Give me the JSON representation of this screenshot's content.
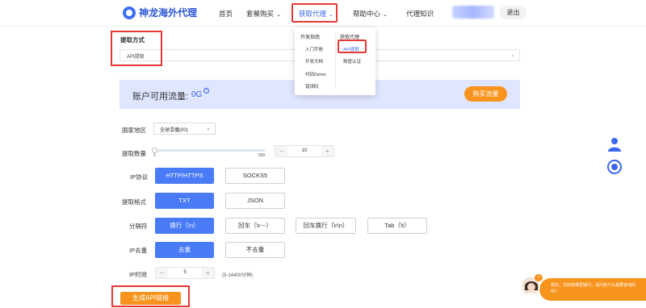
{
  "header": {
    "brand": "神龙海外代理",
    "nav": {
      "home": "首页",
      "packages": "套餐购买",
      "get_proxy": "获取代理",
      "help": "帮助中心",
      "knowledge": "代理知识"
    },
    "logout": "退出"
  },
  "dropdown": {
    "col1": [
      "开发指南",
      "入门手册",
      "开发文档",
      "代码Demo",
      "错误码"
    ],
    "col2": [
      "获取代理",
      "API提取",
      "账密认证"
    ]
  },
  "form": {
    "mode_label": "提取方式",
    "mode_value": "API提取",
    "balance_label": "账户可用流量:",
    "balance_value": "0G",
    "info_glyph": "i",
    "buy_button": "购买流量",
    "region_label": "国家地区",
    "region_value": "全球混播(00)",
    "count_label": "提取数量",
    "slider_min": "1",
    "slider_max": "500",
    "slider_level": 0,
    "count_value": "10",
    "protocol_label": "IP协议",
    "protocol_options": [
      "HTTP/HTTPS",
      "SOCKS5"
    ],
    "format_label": "提取格式",
    "format_options": [
      "TXT",
      "JSON"
    ],
    "separator_label": "分隔符",
    "separator_options": [
      "换行（\\n）",
      "回车（\\r---）",
      "回车换行（\\r\\n）",
      "Tab（\\t）"
    ],
    "dedupe_label": "IP去重",
    "dedupe_options": [
      "去重",
      "不去重"
    ],
    "duration_label": "IP时效",
    "duration_value": "5",
    "duration_hint": "(5-14400分钟)",
    "generate_button": "生成API链接",
    "minus": "−",
    "plus": "+"
  },
  "chat": {
    "message": "您好，当前有哪里疑问，请问有什么需要咨询的吗?",
    "close": "×"
  },
  "colors": {
    "primary": "#4a7bf7",
    "accent": "#f7941d",
    "highlight": "#e53935"
  }
}
